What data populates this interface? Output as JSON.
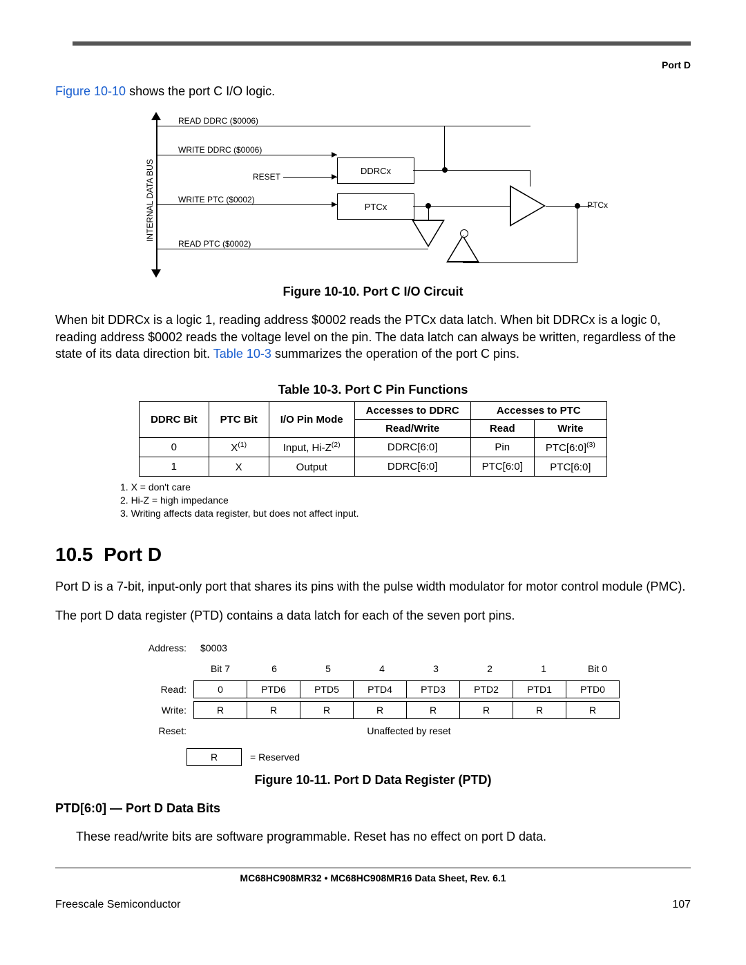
{
  "header": {
    "section_name": "Port D"
  },
  "intro": {
    "fig_ref": "Figure 10-10",
    "after_ref": " shows the port C I/O logic."
  },
  "circuit": {
    "bus_label": "INTERNAL DATA BUS",
    "read_ddrc": "READ DDRC ($0006)",
    "write_ddrc": "WRITE DDRC ($0006)",
    "reset": "RESET",
    "ddrcx": "DDRCx",
    "write_ptc": "WRITE PTC ($0002)",
    "ptcx_box": "PTCx",
    "ptcx_pin": "PTCx",
    "read_ptc": "READ PTC ($0002)"
  },
  "fig_caption": "Figure 10-10. Port C I/O Circuit",
  "para2_pre": "When bit DDRCx is a logic 1, reading address $0002 reads the PTCx data latch. When bit DDRCx is a logic 0, reading address $0002 reads the voltage level on the pin. The data latch can always be written, regardless of the state of its data direction bit. ",
  "para2_link": "Table 10-3",
  "para2_post": " summarizes the operation of the port C pins.",
  "table_caption": "Table 10-3. Port C Pin Functions",
  "table": {
    "headers": {
      "c1": "DDRC Bit",
      "c2": "PTC Bit",
      "c3": "I/O Pin Mode",
      "c4": "Accesses to DDRC",
      "c5": "Accesses to PTC",
      "c4s": "Read/Write",
      "c5r": "Read",
      "c5w": "Write"
    },
    "rows": [
      {
        "c1": "0",
        "c2": "X",
        "c2sup": "(1)",
        "c3": "Input, Hi-Z",
        "c3sup": "(2)",
        "c4": "DDRC[6:0]",
        "c5r": "Pin",
        "c5w": "PTC[6:0]",
        "c5wsup": "(3)"
      },
      {
        "c1": "1",
        "c2": "X",
        "c2sup": "",
        "c3": "Output",
        "c3sup": "",
        "c4": "DDRC[6:0]",
        "c5r": "PTC[6:0]",
        "c5w": "PTC[6:0]",
        "c5wsup": ""
      }
    ]
  },
  "notes": {
    "n1": "1. X = don't care",
    "n2": "2. Hi-Z = high impedance",
    "n3": "3. Writing affects data register, but does not affect input."
  },
  "section": {
    "num": "10.5",
    "title": "Port D"
  },
  "portd_para1": "Port D is a 7-bit, input-only port that shares its pins with the pulse width modulator for motor control module (PMC).",
  "portd_para2": "The port D data register (PTD) contains a data latch for each of the seven port pins.",
  "reg": {
    "address_lbl": "Address:",
    "address_val": "$0003",
    "bits": [
      "Bit 7",
      "6",
      "5",
      "4",
      "3",
      "2",
      "1",
      "Bit 0"
    ],
    "read_lbl": "Read:",
    "read": [
      "0",
      "PTD6",
      "PTD5",
      "PTD4",
      "PTD3",
      "PTD2",
      "PTD1",
      "PTD0"
    ],
    "write_lbl": "Write:",
    "write": [
      "R",
      "R",
      "R",
      "R",
      "R",
      "R",
      "R",
      "R"
    ],
    "reset_lbl": "Reset:",
    "reset_val": "Unaffected by reset",
    "key_cell": "R",
    "key_lbl": "= Reserved"
  },
  "fig2_caption": "Figure 10-11. Port D Data Register (PTD)",
  "bits_head": "PTD[6:0] — Port D Data Bits",
  "bits_desc": "These read/write bits are software programmable. Reset has no effect on port D data.",
  "footer": {
    "doc": "MC68HC908MR32 • MC68HC908MR16 Data Sheet, Rev. 6.1",
    "company": "Freescale Semiconductor",
    "page": "107"
  }
}
